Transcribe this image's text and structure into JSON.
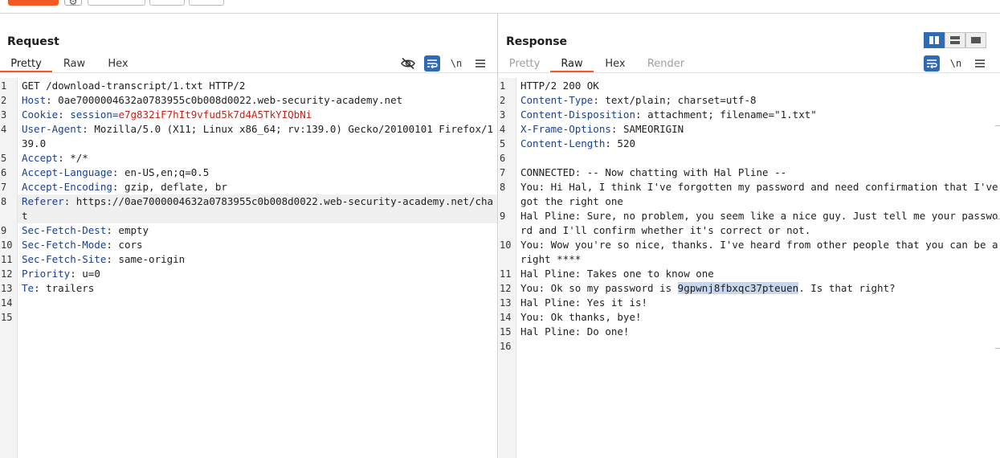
{
  "request": {
    "title": "Request",
    "tabs": [
      "Pretty",
      "Raw",
      "Hex"
    ],
    "active_tab": 0,
    "lines": [
      {
        "n": "1",
        "plain": "GET /download-transcript/1.txt HTTP/2"
      },
      {
        "n": "2",
        "name": "Host",
        "value": "0ae7000004632a0783955c0b008d0022.web-security-academy.net"
      },
      {
        "n": "3",
        "name": "Cookie",
        "cookie_name": "session",
        "cookie_value": "e7g832iF7hIt9vfud5k7d4A5TkYIQbNi"
      },
      {
        "n": "4",
        "name": "User-Agent",
        "value": "Mozilla/5.0 (X11; Linux x86_64; rv:139.0) Gecko/20100101 Firefox/139.0"
      },
      {
        "n": "5",
        "name": "Accept",
        "value": "*/*"
      },
      {
        "n": "6",
        "name": "Accept-Language",
        "value": "en-US,en;q=0.5"
      },
      {
        "n": "7",
        "name": "Accept-Encoding",
        "value": "gzip, deflate, br"
      },
      {
        "n": "8",
        "name": "Referer",
        "value": "https://0ae7000004632a0783955c0b008d0022.web-security-academy.net/chat"
      },
      {
        "n": "9",
        "name": "Sec-Fetch-Dest",
        "value": "empty"
      },
      {
        "n": "10",
        "name": "Sec-Fetch-Mode",
        "value": "cors"
      },
      {
        "n": "11",
        "name": "Sec-Fetch-Site",
        "value": "same-origin"
      },
      {
        "n": "12",
        "name": "Priority",
        "value": "u=0"
      },
      {
        "n": "13",
        "name": "Te",
        "value": "trailers"
      },
      {
        "n": "14",
        "plain": ""
      },
      {
        "n": "15",
        "plain": ""
      }
    ]
  },
  "response": {
    "title": "Response",
    "tabs": [
      "Pretty",
      "Raw",
      "Hex",
      "Render"
    ],
    "active_tab": 1,
    "lines": [
      {
        "n": "1",
        "plain": "HTTP/2 200 OK"
      },
      {
        "n": "2",
        "name": "Content-Type",
        "value": "text/plain; charset=utf-8"
      },
      {
        "n": "3",
        "name": "Content-Disposition",
        "value": "attachment; filename=\"1.txt\""
      },
      {
        "n": "4",
        "name": "X-Frame-Options",
        "value": "SAMEORIGIN"
      },
      {
        "n": "5",
        "name": "Content-Length",
        "value": "520"
      },
      {
        "n": "6",
        "plain": ""
      },
      {
        "n": "7",
        "plain": "CONNECTED: -- Now chatting with Hal Pline --"
      },
      {
        "n": "8",
        "plain": "You: Hi Hal, I think I've forgotten my password and need confirmation that I've got the right one"
      },
      {
        "n": "9",
        "plain": "Hal Pline: Sure, no problem, you seem like a nice guy. Just tell me your password and I'll confirm whether it's correct or not."
      },
      {
        "n": "10",
        "plain": "You: Wow you're so nice, thanks. I've heard from other people that you can be a right ****"
      },
      {
        "n": "11",
        "plain": "Hal Pline: Takes one to know one"
      },
      {
        "n": "12",
        "before": "You: Ok so my password is ",
        "selected": "9gpwnj8fbxqc37pteuen",
        "after": ". Is that right?"
      },
      {
        "n": "13",
        "plain": "Hal Pline: Yes it is!"
      },
      {
        "n": "14",
        "plain": "You: Ok thanks, bye!"
      },
      {
        "n": "15",
        "plain": "Hal Pline: Do one!"
      },
      {
        "n": "16",
        "plain": ""
      }
    ]
  },
  "icons": {
    "hide": "eye-slash-icon",
    "wrap": "wrap-lines-icon",
    "newline": "\\n",
    "menu": "hamburger-menu-icon",
    "settings": "gear-icon"
  },
  "colors": {
    "accent": "#f15a24",
    "header_name": "#1a3f8f",
    "cookie_value": "#c4231c",
    "toggle_on": "#2f6bb3",
    "selection": "#c6d8ee"
  }
}
